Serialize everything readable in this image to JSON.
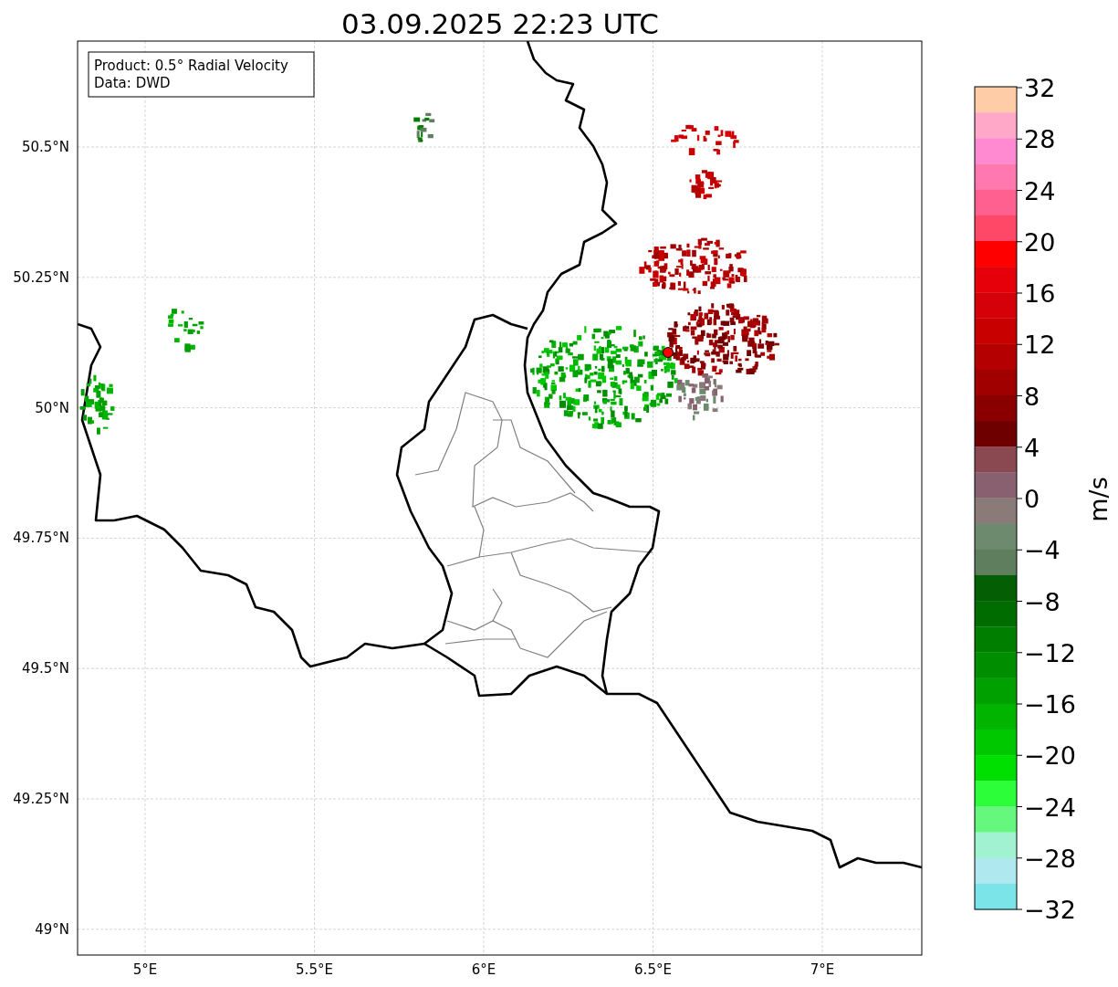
{
  "title": "03.09.2025 22:23 UTC",
  "info_box": [
    "Product: 0.5° Radial Velocity",
    "Data: DWD"
  ],
  "x_ticks": [
    "5°E",
    "5.5°E",
    "6°E",
    "6.5°E",
    "7°E"
  ],
  "y_ticks": [
    "50.5°N",
    "50.25°N",
    "50°N",
    "49.75°N",
    "49.5°N",
    "49.25°N",
    "49°N"
  ],
  "colorbar": {
    "label": "m/s",
    "ticks": [
      "32",
      "28",
      "24",
      "20",
      "16",
      "12",
      "8",
      "4",
      "0",
      "−4",
      "−8",
      "−12",
      "−16",
      "−20",
      "−24",
      "−28",
      "−32"
    ],
    "segments": [
      {
        "color": "#ffcca8"
      },
      {
        "color": "#ffa8c8"
      },
      {
        "color": "#ff8ad2"
      },
      {
        "color": "#ff78b0"
      },
      {
        "color": "#ff6090"
      },
      {
        "color": "#ff4868"
      },
      {
        "color": "#ff0000"
      },
      {
        "color": "#e6000a"
      },
      {
        "color": "#d60008"
      },
      {
        "color": "#c80000"
      },
      {
        "color": "#b40000"
      },
      {
        "color": "#a00000"
      },
      {
        "color": "#8a0000"
      },
      {
        "color": "#6e0000"
      },
      {
        "color": "#8a4850"
      },
      {
        "color": "#886070"
      },
      {
        "color": "#8a7a78"
      },
      {
        "color": "#6e8a6e"
      },
      {
        "color": "#5e7e5e"
      },
      {
        "color": "#045e04"
      },
      {
        "color": "#006c00"
      },
      {
        "color": "#007e00"
      },
      {
        "color": "#008e00"
      },
      {
        "color": "#00a000"
      },
      {
        "color": "#00b400"
      },
      {
        "color": "#00c800"
      },
      {
        "color": "#00e000"
      },
      {
        "color": "#2cfe3a"
      },
      {
        "color": "#66f87e"
      },
      {
        "color": "#a0f2d0"
      },
      {
        "color": "#b0e8f0"
      },
      {
        "color": "#7ae4e8"
      }
    ]
  }
}
